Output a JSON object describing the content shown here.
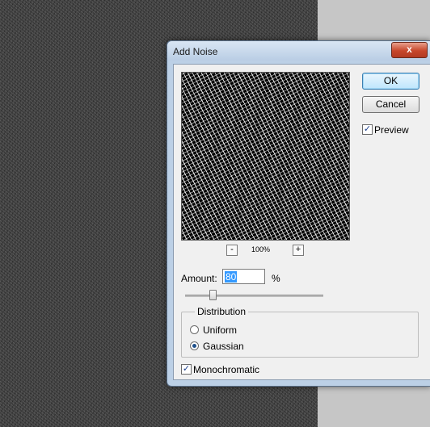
{
  "dialog": {
    "title": "Add Noise",
    "close_label": "x"
  },
  "buttons": {
    "ok": "OK",
    "cancel": "Cancel"
  },
  "preview": {
    "checkbox_label": "Preview",
    "checked": true,
    "zoom_out_label": "-",
    "zoom_in_label": "+",
    "zoom_level": "100%"
  },
  "amount": {
    "label": "Amount:",
    "value": "80",
    "unit": "%",
    "slider_fraction": 0.2
  },
  "distribution": {
    "legend": "Distribution",
    "options": [
      {
        "label": "Uniform",
        "selected": false
      },
      {
        "label": "Gaussian",
        "selected": true
      }
    ]
  },
  "monochromatic": {
    "label": "Monochromatic",
    "checked": true
  },
  "colors": {
    "title_bar": "#b9cde4",
    "close_button": "#c7462b",
    "dialog_bg": "#f0f0f0",
    "selection": "#3399ff"
  }
}
